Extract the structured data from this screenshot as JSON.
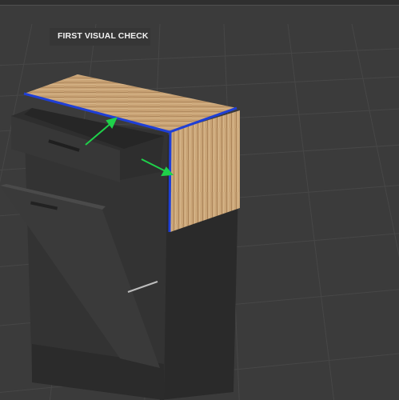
{
  "viewport": {
    "label": "FIRST VISUAL CHECK"
  },
  "scene": {
    "object": "cabinet-model",
    "highlight_color": "#1f3fd6",
    "arrow_color": "#1fd14a",
    "countertop_color": "#c49f73",
    "cabinet_color": "#303030",
    "background_color": "#3b3b3b",
    "grid_color": "#4a4a4a"
  }
}
